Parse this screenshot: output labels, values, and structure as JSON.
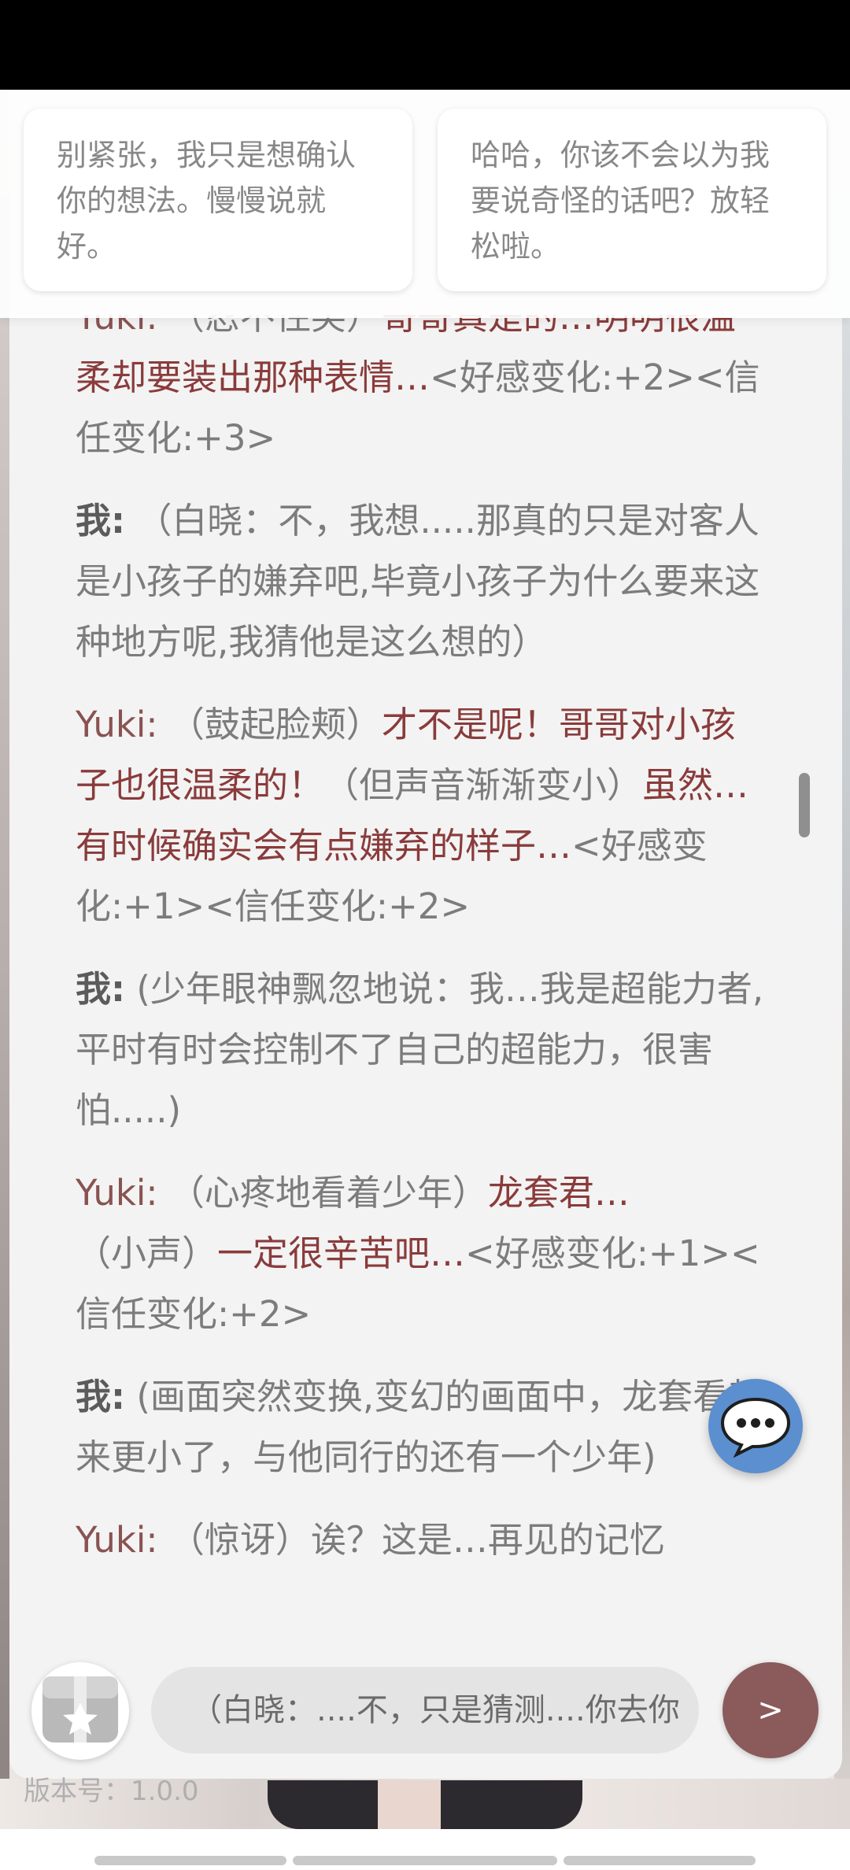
{
  "suggestions": [
    "别紧张，我只是想确认你的想法。慢慢说就好。",
    "哈哈，你该不会以为我要说奇怪的话吧？放轻松啦。"
  ],
  "messages": [
    {
      "speaker": "Yuki:",
      "parts": [
        {
          "t": "（忍不住笑）",
          "s": "plain"
        },
        {
          "t": "哥哥真是的…明明很温柔却要装出那种表情…",
          "s": "em"
        },
        {
          "t": "<好感变化:+2><信任变化:+3>",
          "s": "plain"
        }
      ]
    },
    {
      "speaker": "我:",
      "parts": [
        {
          "t": "（白晓：不，我想.....那真的只是对客人是小孩子的嫌弃吧,毕竟小孩子为什么要来这种地方呢,我猜他是这么想的）",
          "s": "plain"
        }
      ]
    },
    {
      "speaker": "Yuki:",
      "parts": [
        {
          "t": "（鼓起脸颊）",
          "s": "plain"
        },
        {
          "t": "才不是呢！哥哥对小孩子也很温柔的！",
          "s": "em"
        },
        {
          "t": "（但声音渐渐变小）",
          "s": "plain"
        },
        {
          "t": "虽然…有时候确实会有点嫌弃的样子…",
          "s": "em"
        },
        {
          "t": "<好感变化:+1><信任变化:+2>",
          "s": "plain"
        }
      ]
    },
    {
      "speaker": "我:",
      "parts": [
        {
          "t": "(少年眼神飘忽地说：我…我是超能力者,平时有时会控制不了自己的超能力，很害怕.....)",
          "s": "plain"
        }
      ]
    },
    {
      "speaker": "Yuki:",
      "parts": [
        {
          "t": "（心疼地看着少年）",
          "s": "plain"
        },
        {
          "t": "龙套君…",
          "s": "em"
        },
        {
          "t": "（小声）",
          "s": "plain"
        },
        {
          "t": "一定很辛苦吧…",
          "s": "em"
        },
        {
          "t": "<好感变化:+1><信任变化:+2>",
          "s": "plain"
        }
      ]
    },
    {
      "speaker": "我:",
      "parts": [
        {
          "t": "(画面突然变换,变幻的画面中，龙套看起来更小了，与他同行的还有一个少年)",
          "s": "plain"
        }
      ]
    },
    {
      "speaker": "Yuki:",
      "parts": [
        {
          "t": "（惊讶）诶？这是…再见的记忆",
          "s": "plain"
        }
      ]
    }
  ],
  "input": {
    "value": "（白晓：....不，只是猜测....你去你",
    "placeholder": ""
  },
  "send_label": ">",
  "version_label": "版本号：1.0.0",
  "icons": {
    "float": "chat-bubble-icon",
    "gift": "gift-icon",
    "send": "send-icon"
  },
  "colors": {
    "accent": "#8b5a5a",
    "float_button": "#5b8fcf"
  }
}
